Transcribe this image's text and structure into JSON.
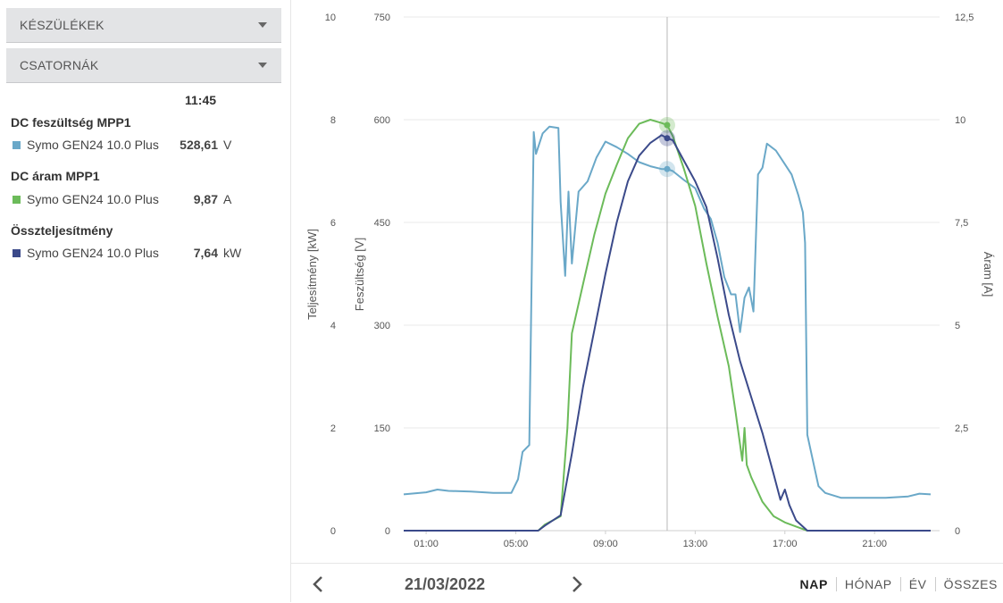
{
  "sidebar": {
    "devices_label": "KÉSZÜLÉKEK",
    "channels_label": "CSATORNÁK",
    "time": "11:45",
    "groups": [
      {
        "title": "DC feszültség MPP1",
        "device": "Symo GEN24 10.0 Plus",
        "value": "528,61",
        "unit": "V",
        "color": "#6aa8c8"
      },
      {
        "title": "DC áram MPP1",
        "device": "Symo GEN24 10.0 Plus",
        "value": "9,87",
        "unit": "A",
        "color": "#6cbb5a"
      },
      {
        "title": "Összteljesítmény",
        "device": "Symo GEN24 10.0 Plus",
        "value": "7,64",
        "unit": "kW",
        "color": "#3b4a8a"
      }
    ]
  },
  "footer": {
    "date": "21/03/2022",
    "periods": [
      "NAP",
      "HÓNAP",
      "ÉV",
      "ÖSSZES"
    ],
    "active_period": "NAP",
    "prev_icon": "chevron-left-icon",
    "next_icon": "chevron-right-icon"
  },
  "chart_data": {
    "type": "line",
    "x_ticks": [
      "01:00",
      "05:00",
      "09:00",
      "13:00",
      "17:00",
      "21:00"
    ],
    "cursor_time": "11:45",
    "axes": {
      "power": {
        "label": "Teljesítmény [kW]",
        "ticks": [
          "0",
          "2",
          "4",
          "6",
          "8",
          "10"
        ],
        "min": 0,
        "max": 10
      },
      "voltage": {
        "label": "Feszültség [V]",
        "ticks": [
          "0",
          "150",
          "300",
          "450",
          "600",
          "750"
        ],
        "min": 0,
        "max": 750
      },
      "current": {
        "label": "Áram [A]",
        "ticks": [
          "0",
          "2,5",
          "5",
          "7,5",
          "10",
          "12,5"
        ],
        "min": 0,
        "max": 12.5
      }
    },
    "series": [
      {
        "axis": "voltage",
        "color": "#6aa8c8",
        "points": [
          [
            0.0,
            53
          ],
          [
            1.0,
            56
          ],
          [
            1.5,
            60
          ],
          [
            2.0,
            58
          ],
          [
            3.0,
            57
          ],
          [
            4.0,
            55
          ],
          [
            4.8,
            55
          ],
          [
            5.1,
            75
          ],
          [
            5.3,
            115
          ],
          [
            5.6,
            125
          ],
          [
            5.8,
            582
          ],
          [
            5.9,
            550
          ],
          [
            6.2,
            580
          ],
          [
            6.5,
            590
          ],
          [
            6.9,
            588
          ],
          [
            7.0,
            480
          ],
          [
            7.2,
            372
          ],
          [
            7.35,
            495
          ],
          [
            7.5,
            390
          ],
          [
            7.8,
            495
          ],
          [
            8.2,
            510
          ],
          [
            8.6,
            545
          ],
          [
            9.0,
            568
          ],
          [
            9.5,
            560
          ],
          [
            10.0,
            550
          ],
          [
            10.5,
            538
          ],
          [
            11.0,
            532
          ],
          [
            11.5,
            528
          ],
          [
            11.75,
            528
          ],
          [
            12.0,
            525
          ],
          [
            12.5,
            512
          ],
          [
            13.0,
            500
          ],
          [
            13.4,
            470
          ],
          [
            13.7,
            455
          ],
          [
            14.0,
            420
          ],
          [
            14.3,
            370
          ],
          [
            14.6,
            345
          ],
          [
            14.8,
            345
          ],
          [
            15.0,
            290
          ],
          [
            15.2,
            340
          ],
          [
            15.4,
            355
          ],
          [
            15.6,
            320
          ],
          [
            15.8,
            520
          ],
          [
            16.0,
            530
          ],
          [
            16.2,
            565
          ],
          [
            16.6,
            555
          ],
          [
            17.0,
            535
          ],
          [
            17.3,
            520
          ],
          [
            17.6,
            490
          ],
          [
            17.8,
            465
          ],
          [
            17.9,
            420
          ],
          [
            18.0,
            140
          ],
          [
            18.2,
            110
          ],
          [
            18.5,
            65
          ],
          [
            18.8,
            55
          ],
          [
            19.5,
            48
          ],
          [
            20.5,
            48
          ],
          [
            21.5,
            48
          ],
          [
            22.5,
            50
          ],
          [
            23.0,
            54
          ],
          [
            23.5,
            53
          ]
        ]
      },
      {
        "axis": "current",
        "color": "#6cbb5a",
        "points": [
          [
            0.0,
            0
          ],
          [
            6.0,
            0
          ],
          [
            6.3,
            0.15
          ],
          [
            7.0,
            0.35
          ],
          [
            7.3,
            2.5
          ],
          [
            7.5,
            4.8
          ],
          [
            8.0,
            6.0
          ],
          [
            8.5,
            7.2
          ],
          [
            9.0,
            8.2
          ],
          [
            9.5,
            8.9
          ],
          [
            10.0,
            9.55
          ],
          [
            10.5,
            9.9
          ],
          [
            11.0,
            10.0
          ],
          [
            11.5,
            9.92
          ],
          [
            11.75,
            9.87
          ],
          [
            12.0,
            9.6
          ],
          [
            12.5,
            8.8
          ],
          [
            13.0,
            7.9
          ],
          [
            13.5,
            6.5
          ],
          [
            14.0,
            5.2
          ],
          [
            14.5,
            4.0
          ],
          [
            14.8,
            2.9
          ],
          [
            15.0,
            2.1
          ],
          [
            15.1,
            1.7
          ],
          [
            15.2,
            2.5
          ],
          [
            15.3,
            1.6
          ],
          [
            15.5,
            1.3
          ],
          [
            16.0,
            0.7
          ],
          [
            16.5,
            0.35
          ],
          [
            17.0,
            0.2
          ],
          [
            17.5,
            0.1
          ],
          [
            18.0,
            0
          ],
          [
            23.5,
            0
          ]
        ]
      },
      {
        "axis": "power",
        "color": "#3b4a8a",
        "points": [
          [
            0.0,
            0
          ],
          [
            6.0,
            0
          ],
          [
            6.3,
            0.1
          ],
          [
            7.0,
            0.3
          ],
          [
            7.5,
            1.5
          ],
          [
            8.0,
            2.8
          ],
          [
            8.5,
            3.9
          ],
          [
            9.0,
            5.0
          ],
          [
            9.5,
            6.0
          ],
          [
            10.0,
            6.8
          ],
          [
            10.5,
            7.3
          ],
          [
            11.0,
            7.55
          ],
          [
            11.5,
            7.7
          ],
          [
            11.75,
            7.64
          ],
          [
            12.0,
            7.6
          ],
          [
            12.5,
            7.2
          ],
          [
            13.0,
            6.8
          ],
          [
            13.5,
            6.3
          ],
          [
            14.0,
            5.3
          ],
          [
            14.5,
            4.2
          ],
          [
            15.0,
            3.3
          ],
          [
            15.5,
            2.6
          ],
          [
            16.0,
            1.9
          ],
          [
            16.5,
            1.1
          ],
          [
            16.8,
            0.6
          ],
          [
            17.0,
            0.8
          ],
          [
            17.2,
            0.5
          ],
          [
            17.5,
            0.2
          ],
          [
            18.0,
            0
          ],
          [
            23.5,
            0
          ]
        ]
      }
    ]
  }
}
